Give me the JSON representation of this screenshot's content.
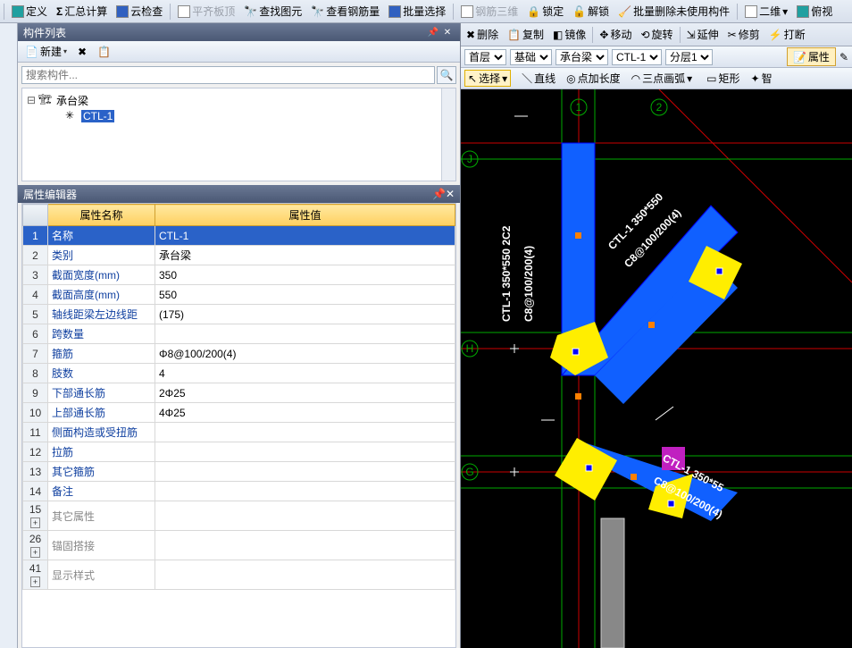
{
  "topbar": {
    "define": "定义",
    "sum_calc": "汇总计算",
    "cloud_check": "云检查",
    "flat_board": "平齐板顶",
    "find_elem": "查找图元",
    "view_rebar": "查看钢筋量",
    "batch_sel": "批量选择",
    "rebar_3d": "钢筋三维",
    "lock": "锁定",
    "unlock": "解锁",
    "batch_del": "批量删除未使用构件",
    "view_2d": "二维",
    "view_persp": "俯视"
  },
  "panel": {
    "title": "构件列表",
    "new": "新建",
    "search_ph": "搜索构件..."
  },
  "tree": {
    "root": "承台梁",
    "child": "CTL-1"
  },
  "prop_panel": {
    "title": "属性编辑器",
    "col_name": "属性名称",
    "col_value": "属性值"
  },
  "props": [
    {
      "n": "1",
      "name": "名称",
      "val": "CTL-1",
      "sel": true
    },
    {
      "n": "2",
      "name": "类别",
      "val": "承台梁"
    },
    {
      "n": "3",
      "name": "截面宽度(mm)",
      "val": "350"
    },
    {
      "n": "4",
      "name": "截面高度(mm)",
      "val": "550"
    },
    {
      "n": "5",
      "name": "轴线距梁左边线距",
      "val": "(175)"
    },
    {
      "n": "6",
      "name": "跨数量",
      "val": ""
    },
    {
      "n": "7",
      "name": "箍筋",
      "val": "Φ8@100/200(4)"
    },
    {
      "n": "8",
      "name": "肢数",
      "val": "4"
    },
    {
      "n": "9",
      "name": "下部通长筋",
      "val": "2Φ25"
    },
    {
      "n": "10",
      "name": "上部通长筋",
      "val": "4Φ25"
    },
    {
      "n": "11",
      "name": "侧面构造或受扭筋",
      "val": ""
    },
    {
      "n": "12",
      "name": "拉筋",
      "val": ""
    },
    {
      "n": "13",
      "name": "其它箍筋",
      "val": ""
    },
    {
      "n": "14",
      "name": "备注",
      "val": ""
    }
  ],
  "prop_groups": [
    {
      "n": "15",
      "name": "其它属性"
    },
    {
      "n": "26",
      "name": "锚固搭接"
    },
    {
      "n": "41",
      "name": "显示样式"
    }
  ],
  "rtoolbar": {
    "delete": "删除",
    "copy": "复制",
    "mirror": "镜像",
    "move": "移动",
    "rotate": "旋转",
    "extend": "延伸",
    "trim": "修剪",
    "break": "打断"
  },
  "combos": {
    "floor": "首层",
    "cat": "基础",
    "type": "承台梁",
    "item": "CTL-1",
    "layer": "分层1",
    "prop": "属性"
  },
  "drawbar": {
    "select": "选择",
    "line": "直线",
    "addlen": "点加长度",
    "arc3": "三点画弧",
    "rect": "矩形",
    "smart": "智"
  },
  "annot": {
    "a1": "CTL-1 350*550 2C2",
    "a2": "C8@100/200(4)",
    "a3": "CTL-1 350*550",
    "a4": "C8@100/200(4)",
    "a5": "CTL-1 350*55",
    "a6": "C8@100/200(4)"
  },
  "axis": {
    "j": "J",
    "h": "H",
    "g": "G",
    "c1": "1",
    "c2": "2"
  }
}
